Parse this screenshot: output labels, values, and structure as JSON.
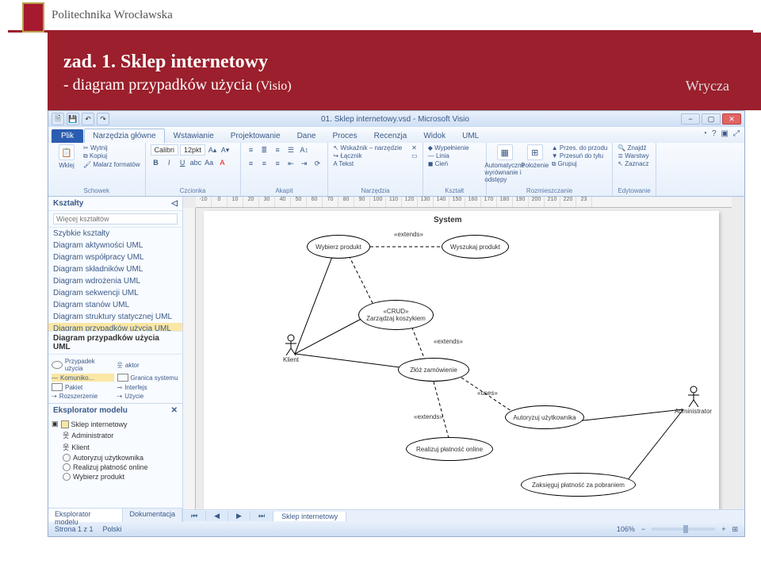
{
  "header": {
    "university": "Politechnika Wrocławska",
    "title": "zad. 1. Sklep internetowy",
    "subtitle_prefix": "- diagram przypadków użycia ",
    "subtitle_suffix": "(Visio)",
    "author": "Wrycza"
  },
  "visioTitle": "01. Sklep internetowy.vsd - Microsoft Visio",
  "qat": [
    "🗎",
    "💾",
    "↶",
    "↷"
  ],
  "windowControls": {
    "min": "−",
    "max": "▢",
    "close": "✕"
  },
  "helpIcons": [
    "◔",
    "?",
    "▣",
    "⤢"
  ],
  "fileTab": "Plik",
  "ribbonTabs": [
    "Narzędzia główne",
    "Wstawianie",
    "Projektowanie",
    "Dane",
    "Proces",
    "Recenzja",
    "Widok",
    "UML"
  ],
  "ribbon": {
    "clipboard": {
      "paste": "Wklej",
      "cut": "Wytnij",
      "copy": "Kopiuj",
      "format": "Malarz formatów",
      "label": "Schowek"
    },
    "font": {
      "name": "Calibri",
      "size": "12pkt",
      "label": "Czcionka"
    },
    "para": {
      "label": "Akapit"
    },
    "tools": {
      "pointer": "Wskaźnik – narzędzie",
      "connector": "Łącznik",
      "text": "Tekst",
      "label": "Narzędzia"
    },
    "shape": {
      "fill": "Wypełnienie",
      "line": "Linia",
      "shadow": "Cień",
      "label": "Kształt"
    },
    "arrange": {
      "auto": "Automatyczne wyrównanie i odstępy",
      "position": "Położenie",
      "front": "Przes. do przodu",
      "back": "Przesuń do tyłu",
      "group": "Grupuj",
      "label": "Rozmieszczanie"
    },
    "edit": {
      "find": "Znajdź",
      "layers": "Warstwy",
      "select": "Zaznacz",
      "label": "Edytowanie"
    }
  },
  "shapesPanel": {
    "title": "Kształty",
    "search_placeholder": "Więcej kształtów",
    "quick": "Szybkie kształty",
    "categories": [
      "Diagram aktywności UML",
      "Diagram współpracy UML",
      "Diagram składników UML",
      "Diagram wdrożenia UML",
      "Diagram sekwencji UML",
      "Diagram stanów UML",
      "Diagram struktury statycznej UML",
      "Diagram przypadków użycia UML"
    ],
    "activeStencil": "Diagram przypadków użycia UML",
    "stencilItems": [
      {
        "label": "Przypadek użycia"
      },
      {
        "label": "aktor"
      },
      {
        "label": "Komuniko..."
      },
      {
        "label": "Granica systemu"
      },
      {
        "label": "Pakiet"
      },
      {
        "label": "Interfejs"
      },
      {
        "label": "Rozszerzenie"
      },
      {
        "label": "Użycie"
      }
    ]
  },
  "explorer": {
    "title": "Eksplorator modelu",
    "root": "Sklep internetowy",
    "items": [
      "Administrator",
      "Klient",
      "Autoryzuj użytkownika",
      "Realizuj płatność online",
      "Wybierz produkt"
    ]
  },
  "sideTabs": {
    "explorer": "Eksplorator modelu",
    "doc": "Dokumentacja"
  },
  "canvas": {
    "system": "System",
    "usecases": {
      "wybierz": "Wybierz produkt",
      "wyszukaj": "Wyszukaj produkt",
      "crud": "«CRUD»",
      "zarzadzaj": "Zarządzaj koszykiem",
      "zloz": "Złóż zamówienie",
      "autoryzuj": "Autoryzuj użytkownika",
      "realizuj": "Realizuj płatność online",
      "zaksieguj": "Zaksięguj płatność za pobraniem"
    },
    "ext": "«extends»",
    "uses": "«uses»",
    "actors": {
      "klient": "Klient",
      "admin": "Administrator"
    }
  },
  "rulerTicks": [
    "-10",
    "0",
    "10",
    "20",
    "30",
    "40",
    "50",
    "60",
    "70",
    "80",
    "90",
    "100",
    "110",
    "120",
    "130",
    "140",
    "150",
    "160",
    "170",
    "180",
    "190",
    "200",
    "210",
    "220",
    "23"
  ],
  "pageTabs": {
    "nav": [
      "⏮",
      "◀",
      "▶",
      "⏭"
    ],
    "page": "Sklep internetowy"
  },
  "status": {
    "page": "Strona 1 z 1",
    "lang": "Polski",
    "zoom": "106%",
    "fit": "⊞"
  }
}
